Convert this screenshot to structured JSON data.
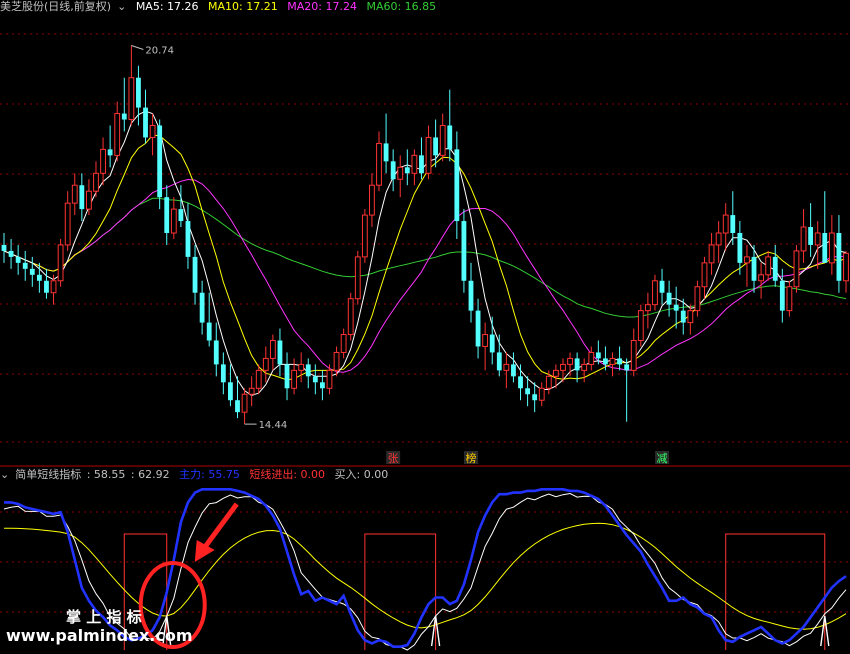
{
  "main_header": {
    "stock_name": "美芝股份",
    "period": "(日线,前复权)",
    "indicators": [
      {
        "label": "MA5: 17.26",
        "color": "#ffffff"
      },
      {
        "label": "MA10: 17.21",
        "color": "#ffff00"
      },
      {
        "label": "MA20: 17.24",
        "color": "#ff33ff"
      },
      {
        "label": "MA60: 16.85",
        "color": "#33cc33"
      }
    ]
  },
  "sub_header": {
    "name": "简单短线指标",
    "values": [
      {
        "label": ": 58.55",
        "color": "#c0c0c0"
      },
      {
        "label": ": 62.92",
        "color": "#c0c0c0"
      },
      {
        "label": "主力: 55.75",
        "color": "#2233ff"
      },
      {
        "label": "短线进出: 0.00",
        "color": "#ff3333"
      },
      {
        "label": "买入: 0.00",
        "color": "#c0c0c0"
      }
    ]
  },
  "annotations": {
    "high": "20.74",
    "low": "14.44",
    "markers": [
      {
        "text": "张",
        "color": "#ff3333",
        "index": 55
      },
      {
        "text": "榜",
        "color": "#ffcc00",
        "index": 66
      },
      {
        "text": "减",
        "color": "#33ff66",
        "index": 93
      }
    ]
  },
  "watermark": {
    "cn": "掌 上 指 标",
    "url": "www.palmindex.com"
  },
  "colors": {
    "up": "#ff3333",
    "down": "#54ffff",
    "grid": "#8b0000",
    "ma5": "#ffffff",
    "ma10": "#ffff00",
    "ma20": "#ff33ff",
    "ma60": "#33cc33",
    "main_force": "#2233ff",
    "short_signal": "#ff3333",
    "circle": "#ff2222"
  },
  "chart_data": {
    "type": "candlestick",
    "ylim": [
      14.0,
      21.2
    ],
    "candles": [
      [
        17.4,
        17.6,
        17.1,
        17.3
      ],
      [
        17.3,
        17.5,
        17.0,
        17.2
      ],
      [
        17.2,
        17.4,
        16.9,
        17.1
      ],
      [
        17.1,
        17.3,
        16.8,
        17.0
      ],
      [
        17.0,
        17.2,
        16.7,
        16.9
      ],
      [
        16.9,
        17.1,
        16.6,
        16.8
      ],
      [
        16.8,
        17.0,
        16.5,
        16.6
      ],
      [
        16.6,
        16.9,
        16.4,
        16.8
      ],
      [
        16.8,
        17.5,
        16.7,
        17.4
      ],
      [
        17.4,
        18.3,
        17.3,
        18.1
      ],
      [
        18.1,
        18.6,
        17.9,
        18.4
      ],
      [
        18.4,
        18.6,
        17.8,
        18.0
      ],
      [
        18.0,
        18.5,
        17.9,
        18.3
      ],
      [
        18.3,
        18.8,
        18.2,
        18.6
      ],
      [
        18.6,
        19.2,
        18.4,
        19.0
      ],
      [
        19.0,
        19.4,
        18.7,
        18.9
      ],
      [
        18.9,
        19.8,
        18.8,
        19.6
      ],
      [
        19.6,
        20.2,
        19.3,
        19.5
      ],
      [
        19.5,
        20.74,
        19.4,
        20.2
      ],
      [
        20.2,
        20.4,
        19.4,
        19.7
      ],
      [
        19.7,
        20.0,
        19.1,
        19.2
      ],
      [
        19.2,
        19.6,
        18.9,
        19.4
      ],
      [
        19.4,
        19.5,
        18.0,
        18.2
      ],
      [
        18.2,
        18.4,
        17.4,
        17.6
      ],
      [
        17.6,
        18.2,
        17.5,
        18.0
      ],
      [
        18.0,
        18.4,
        17.7,
        17.8
      ],
      [
        17.8,
        18.1,
        17.0,
        17.2
      ],
      [
        17.2,
        17.4,
        16.4,
        16.6
      ],
      [
        16.6,
        16.8,
        15.9,
        16.1
      ],
      [
        16.1,
        16.6,
        15.7,
        15.8
      ],
      [
        15.8,
        16.1,
        15.2,
        15.4
      ],
      [
        15.4,
        15.6,
        14.9,
        15.1
      ],
      [
        15.1,
        15.4,
        14.7,
        14.8
      ],
      [
        14.8,
        15.2,
        14.5,
        14.6
      ],
      [
        14.6,
        15.0,
        14.4,
        14.9
      ],
      [
        14.9,
        15.2,
        14.7,
        15.0
      ],
      [
        15.0,
        15.4,
        14.9,
        15.3
      ],
      [
        15.3,
        15.7,
        15.1,
        15.5
      ],
      [
        15.5,
        15.9,
        15.3,
        15.8
      ],
      [
        15.8,
        16.0,
        15.2,
        15.4
      ],
      [
        15.4,
        15.6,
        14.8,
        15.0
      ],
      [
        15.0,
        15.5,
        14.9,
        15.3
      ],
      [
        15.3,
        15.6,
        15.1,
        15.4
      ],
      [
        15.4,
        15.5,
        15.0,
        15.2
      ],
      [
        15.2,
        15.4,
        14.9,
        15.1
      ],
      [
        15.1,
        15.3,
        14.8,
        15.0
      ],
      [
        15.0,
        15.4,
        14.9,
        15.3
      ],
      [
        15.3,
        15.7,
        15.2,
        15.6
      ],
      [
        15.6,
        16.0,
        15.5,
        15.9
      ],
      [
        15.9,
        16.6,
        15.8,
        16.5
      ],
      [
        16.5,
        17.3,
        16.4,
        17.2
      ],
      [
        17.2,
        18.0,
        17.1,
        17.9
      ],
      [
        17.9,
        18.6,
        17.7,
        18.4
      ],
      [
        18.4,
        19.3,
        18.3,
        19.1
      ],
      [
        19.1,
        19.6,
        18.6,
        18.8
      ],
      [
        18.8,
        19.0,
        18.3,
        18.5
      ],
      [
        18.5,
        18.9,
        18.2,
        18.7
      ],
      [
        18.7,
        19.0,
        18.4,
        18.6
      ],
      [
        18.6,
        19.0,
        18.4,
        18.9
      ],
      [
        18.9,
        19.2,
        18.5,
        18.6
      ],
      [
        18.6,
        19.4,
        18.5,
        19.2
      ],
      [
        19.2,
        19.5,
        18.7,
        18.9
      ],
      [
        18.9,
        19.6,
        18.8,
        19.4
      ],
      [
        19.4,
        20.0,
        18.8,
        19.0
      ],
      [
        19.0,
        19.3,
        17.5,
        17.8
      ],
      [
        17.8,
        18.0,
        16.6,
        16.8
      ],
      [
        16.8,
        17.1,
        16.1,
        16.3
      ],
      [
        16.3,
        16.5,
        15.5,
        15.7
      ],
      [
        15.7,
        16.1,
        15.3,
        15.9
      ],
      [
        15.9,
        16.2,
        15.4,
        15.6
      ],
      [
        15.6,
        15.9,
        15.2,
        15.3
      ],
      [
        15.3,
        15.6,
        15.0,
        15.4
      ],
      [
        15.4,
        15.6,
        15.1,
        15.2
      ],
      [
        15.2,
        15.4,
        14.8,
        15.0
      ],
      [
        15.0,
        15.2,
        14.7,
        14.9
      ],
      [
        14.9,
        15.1,
        14.6,
        14.8
      ],
      [
        14.8,
        15.1,
        14.7,
        15.0
      ],
      [
        15.0,
        15.3,
        14.9,
        15.2
      ],
      [
        15.2,
        15.4,
        15.0,
        15.3
      ],
      [
        15.3,
        15.5,
        15.1,
        15.4
      ],
      [
        15.4,
        15.6,
        15.2,
        15.5
      ],
      [
        15.5,
        15.6,
        15.1,
        15.3
      ],
      [
        15.3,
        15.5,
        15.1,
        15.4
      ],
      [
        15.4,
        15.7,
        15.3,
        15.6
      ],
      [
        15.6,
        15.8,
        15.4,
        15.5
      ],
      [
        15.5,
        15.7,
        15.3,
        15.4
      ],
      [
        15.4,
        15.6,
        15.2,
        15.5
      ],
      [
        15.5,
        15.7,
        15.3,
        15.4
      ],
      [
        15.4,
        15.5,
        14.44,
        15.3
      ],
      [
        15.3,
        16.0,
        15.2,
        15.8
      ],
      [
        15.8,
        16.4,
        15.7,
        16.3
      ],
      [
        16.3,
        16.6,
        16.0,
        16.4
      ],
      [
        16.4,
        16.9,
        16.3,
        16.8
      ],
      [
        16.8,
        17.0,
        16.4,
        16.6
      ],
      [
        16.6,
        16.8,
        16.2,
        16.4
      ],
      [
        16.4,
        16.7,
        16.0,
        16.3
      ],
      [
        16.3,
        16.5,
        15.9,
        16.1
      ],
      [
        16.1,
        16.4,
        15.9,
        16.3
      ],
      [
        16.3,
        16.8,
        16.2,
        16.7
      ],
      [
        16.7,
        17.2,
        16.5,
        17.1
      ],
      [
        17.1,
        17.6,
        16.9,
        17.4
      ],
      [
        17.4,
        17.8,
        17.1,
        17.6
      ],
      [
        17.6,
        18.1,
        17.3,
        17.9
      ],
      [
        17.9,
        18.3,
        17.4,
        17.6
      ],
      [
        17.6,
        17.8,
        16.9,
        17.1
      ],
      [
        17.1,
        17.4,
        16.7,
        17.2
      ],
      [
        17.2,
        17.4,
        16.6,
        16.8
      ],
      [
        16.8,
        17.1,
        16.5,
        16.9
      ],
      [
        16.9,
        17.3,
        16.8,
        17.2
      ],
      [
        17.2,
        17.4,
        16.7,
        16.8
      ],
      [
        16.8,
        17.0,
        16.1,
        16.3
      ],
      [
        16.3,
        16.8,
        16.2,
        16.7
      ],
      [
        16.7,
        17.4,
        16.6,
        17.3
      ],
      [
        17.3,
        18.0,
        17.1,
        17.7
      ],
      [
        17.7,
        18.1,
        17.2,
        17.4
      ],
      [
        17.4,
        17.8,
        17.0,
        17.6
      ],
      [
        17.6,
        18.3,
        17.4,
        17.1
      ],
      [
        17.1,
        17.9,
        16.9,
        17.6
      ],
      [
        17.6,
        17.9,
        16.6,
        16.8
      ],
      [
        16.8,
        17.3,
        16.6,
        17.26
      ]
    ],
    "main_force": [
      90,
      90,
      89,
      87,
      86,
      85,
      84,
      83,
      84,
      72,
      55,
      38,
      30,
      24,
      20,
      15,
      12,
      8,
      6,
      7,
      9,
      12,
      20,
      35,
      55,
      78,
      90,
      96,
      98,
      98,
      98,
      98,
      98,
      97,
      96,
      94,
      92,
      88,
      82,
      74,
      60,
      46,
      34,
      36,
      30,
      32,
      30,
      28,
      33,
      22,
      12,
      6,
      4,
      6,
      5,
      2,
      2,
      3,
      10,
      20,
      28,
      32,
      32,
      28,
      30,
      40,
      55,
      72,
      82,
      90,
      95,
      95,
      96,
      96,
      97,
      97,
      98,
      98,
      98,
      98,
      97,
      97,
      96,
      94,
      92,
      88,
      82,
      76,
      70,
      65,
      60,
      52,
      45,
      38,
      30,
      30,
      32,
      28,
      26,
      22,
      20,
      12,
      6,
      5,
      8,
      10,
      12,
      14,
      10,
      6,
      4,
      6,
      10,
      14,
      20,
      26,
      32,
      38,
      42,
      45
    ]
  }
}
